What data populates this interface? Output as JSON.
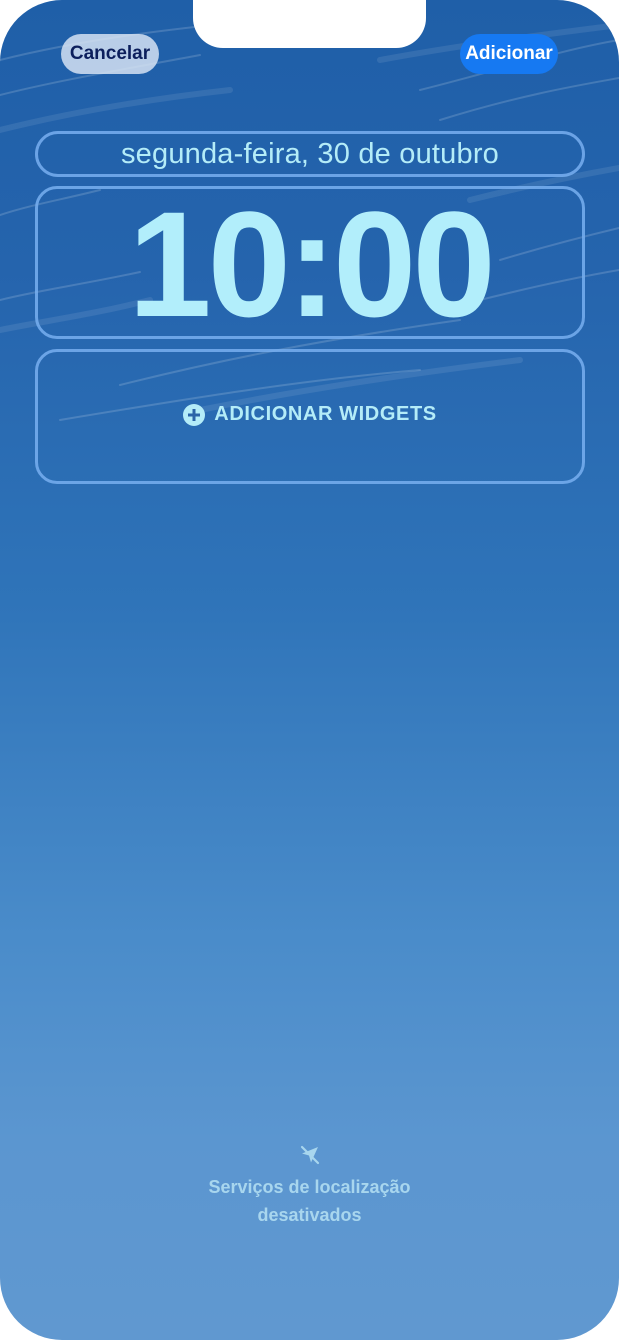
{
  "toolbar": {
    "cancel_label": "Cancelar",
    "add_label": "Adicionar"
  },
  "lockscreen": {
    "date": "segunda-feira, 30 de outubro",
    "time": "10:00",
    "widgets_label": "ADICIONAR WIDGETS",
    "widgets_icon": "plus-circle-icon"
  },
  "location_status": {
    "icon": "location-off-icon",
    "text": "Serviços de localização desativados"
  },
  "colors": {
    "accent_button": "#1679f2",
    "text_light_cyan": "#b4ecf8",
    "cancel_text": "#0c1f5c"
  }
}
